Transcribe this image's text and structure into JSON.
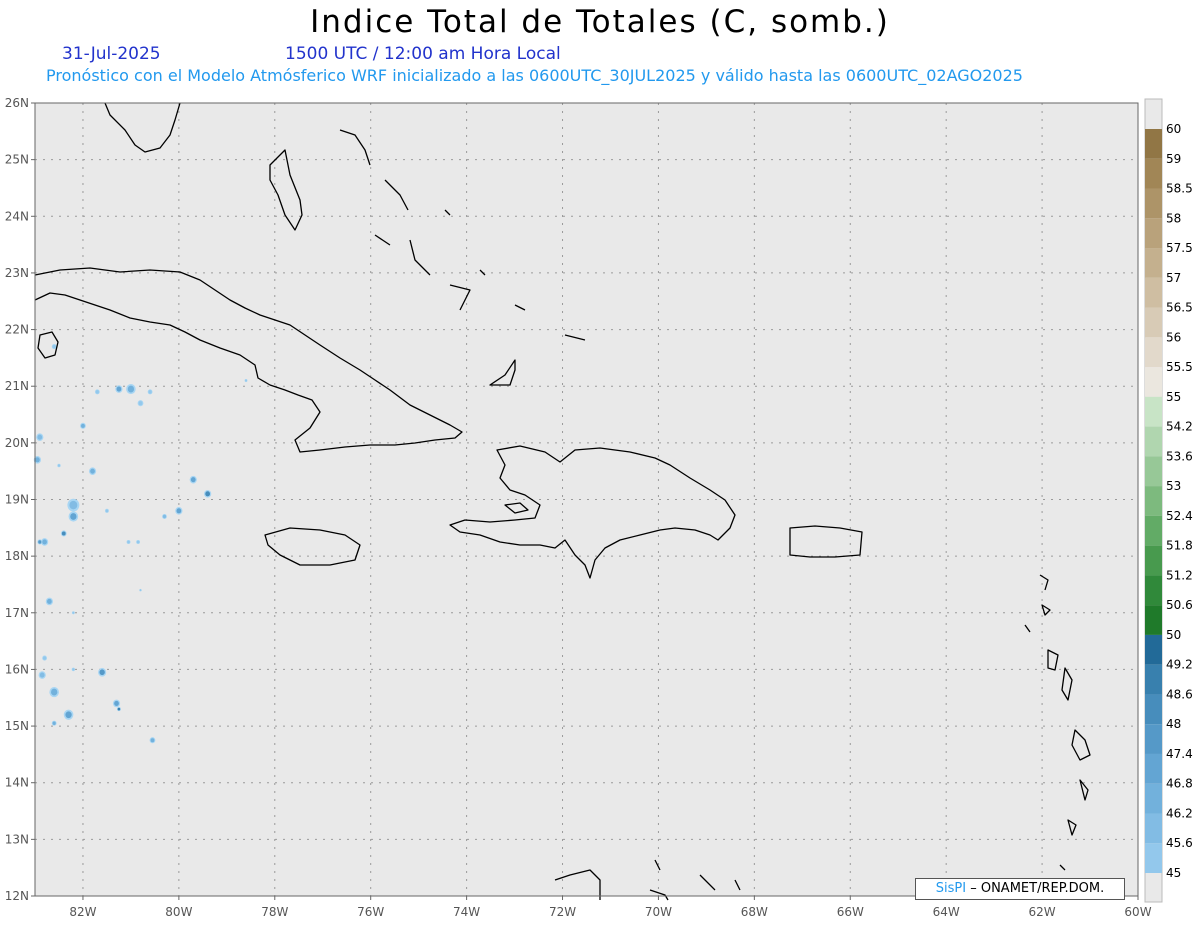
{
  "header": {
    "title": "Indice Total de Totales (C, somb.)",
    "date": "31-Jul-2025",
    "time": "1500 UTC / 12:00 am Hora Local",
    "subtitle": "Pronóstico con el Modelo Atmósferico WRF inicializado a las 0600UTC_30JUL2025 y válido hasta las  0600UTC_02AGO2025"
  },
  "credit": {
    "brand": "SisPI",
    "org": " – ONAMET/REP.DOM."
  },
  "map": {
    "lon_range": [
      -83,
      -60
    ],
    "lat_range": [
      12,
      26
    ],
    "lon_ticks": [
      {
        "lon": -82,
        "label": "82W"
      },
      {
        "lon": -80,
        "label": "80W"
      },
      {
        "lon": -78,
        "label": "78W"
      },
      {
        "lon": -76,
        "label": "76W"
      },
      {
        "lon": -74,
        "label": "74W"
      },
      {
        "lon": -72,
        "label": "72W"
      },
      {
        "lon": -70,
        "label": "70W"
      },
      {
        "lon": -68,
        "label": "68W"
      },
      {
        "lon": -66,
        "label": "66W"
      },
      {
        "lon": -64,
        "label": "64W"
      },
      {
        "lon": -62,
        "label": "62W"
      },
      {
        "lon": -60,
        "label": "60W"
      }
    ],
    "lat_ticks": [
      {
        "lat": 26,
        "label": "26N"
      },
      {
        "lat": 25,
        "label": "25N"
      },
      {
        "lat": 24,
        "label": "24N"
      },
      {
        "lat": 23,
        "label": "23N"
      },
      {
        "lat": 22,
        "label": "22N"
      },
      {
        "lat": 21,
        "label": "21N"
      },
      {
        "lat": 20,
        "label": "20N"
      },
      {
        "lat": 19,
        "label": "19N"
      },
      {
        "lat": 18,
        "label": "18N"
      },
      {
        "lat": 17,
        "label": "17N"
      },
      {
        "lat": 16,
        "label": "16N"
      },
      {
        "lat": 15,
        "label": "15N"
      },
      {
        "lat": 14,
        "label": "14N"
      },
      {
        "lat": 13,
        "label": "13N"
      },
      {
        "lat": 12,
        "label": "12N"
      }
    ],
    "grid": true,
    "background": "#e9e9e9",
    "coastline_color": "#000000"
  },
  "colorbar": {
    "levels": [
      {
        "label": "45",
        "color": "#a9d6f3"
      },
      {
        "label": "45.6",
        "color": "#93c8ec"
      },
      {
        "label": "46.2",
        "color": "#82bce4"
      },
      {
        "label": "46.8",
        "color": "#72b1dc"
      },
      {
        "label": "47.4",
        "color": "#63a5d3"
      },
      {
        "label": "48",
        "color": "#5599c8"
      },
      {
        "label": "48.6",
        "color": "#478dbc"
      },
      {
        "label": "49.2",
        "color": "#3880ae"
      },
      {
        "label": "50",
        "color": "#226a98"
      },
      {
        "label": "50.6",
        "color": "#1f7a2a"
      },
      {
        "label": "51.2",
        "color": "#30893a"
      },
      {
        "label": "51.8",
        "color": "#489a4e"
      },
      {
        "label": "52.4",
        "color": "#62ab66"
      },
      {
        "label": "53",
        "color": "#7dba7e"
      },
      {
        "label": "53.6",
        "color": "#97c897"
      },
      {
        "label": "54.2",
        "color": "#b0d6af"
      },
      {
        "label": "55",
        "color": "#c8e4c6"
      },
      {
        "label": "55.5",
        "color": "#ebe7df"
      },
      {
        "label": "56",
        "color": "#e2d9cb"
      },
      {
        "label": "56.5",
        "color": "#d8cbb6"
      },
      {
        "label": "57",
        "color": "#cfbea2"
      },
      {
        "label": "57.5",
        "color": "#c4b08e"
      },
      {
        "label": "58",
        "color": "#b9a27b"
      },
      {
        "label": "58.5",
        "color": "#ad9468"
      },
      {
        "label": "59",
        "color": "#a18656"
      },
      {
        "label": "60",
        "color": "#917645"
      }
    ]
  },
  "cells": [
    {
      "lon": -82.9,
      "lat": 20.1,
      "r": 0.15,
      "v": 46.2
    },
    {
      "lon": -82.95,
      "lat": 19.7,
      "r": 0.15,
      "v": 46.8
    },
    {
      "lon": -82.2,
      "lat": 18.9,
      "r": 0.25,
      "v": 46.2
    },
    {
      "lon": -82.2,
      "lat": 18.7,
      "r": 0.2,
      "v": 47.4
    },
    {
      "lon": -82.4,
      "lat": 18.4,
      "r": 0.12,
      "v": 48.6
    },
    {
      "lon": -82.8,
      "lat": 18.25,
      "r": 0.15,
      "v": 46.8
    },
    {
      "lon": -82.9,
      "lat": 18.25,
      "r": 0.1,
      "v": 48
    },
    {
      "lon": -81.8,
      "lat": 19.5,
      "r": 0.15,
      "v": 46.8
    },
    {
      "lon": -82.5,
      "lat": 19.6,
      "r": 0.07,
      "v": 45.6
    },
    {
      "lon": -81.0,
      "lat": 20.95,
      "r": 0.2,
      "v": 46.8
    },
    {
      "lon": -81.25,
      "lat": 20.95,
      "r": 0.15,
      "v": 47.4
    },
    {
      "lon": -81.7,
      "lat": 20.9,
      "r": 0.1,
      "v": 45.6
    },
    {
      "lon": -80.6,
      "lat": 20.9,
      "r": 0.1,
      "v": 45.6
    },
    {
      "lon": -80.8,
      "lat": 20.7,
      "r": 0.12,
      "v": 45.6
    },
    {
      "lon": -82.0,
      "lat": 20.3,
      "r": 0.12,
      "v": 46.8
    },
    {
      "lon": -79.7,
      "lat": 19.35,
      "r": 0.15,
      "v": 47.4
    },
    {
      "lon": -79.4,
      "lat": 19.1,
      "r": 0.15,
      "v": 48.6
    },
    {
      "lon": -80.0,
      "lat": 18.8,
      "r": 0.15,
      "v": 47.4
    },
    {
      "lon": -80.3,
      "lat": 18.7,
      "r": 0.1,
      "v": 46.2
    },
    {
      "lon": -82.7,
      "lat": 17.2,
      "r": 0.15,
      "v": 46.8
    },
    {
      "lon": -82.2,
      "lat": 17.0,
      "r": 0.06,
      "v": 45.6
    },
    {
      "lon": -81.6,
      "lat": 15.95,
      "r": 0.17,
      "v": 48
    },
    {
      "lon": -81.3,
      "lat": 15.4,
      "r": 0.15,
      "v": 47.4
    },
    {
      "lon": -81.25,
      "lat": 15.3,
      "r": 0.08,
      "v": 49.2
    },
    {
      "lon": -82.6,
      "lat": 15.6,
      "r": 0.2,
      "v": 46.8
    },
    {
      "lon": -82.3,
      "lat": 15.2,
      "r": 0.2,
      "v": 47.4
    },
    {
      "lon": -82.6,
      "lat": 15.05,
      "r": 0.1,
      "v": 46.8
    },
    {
      "lon": -82.85,
      "lat": 15.9,
      "r": 0.15,
      "v": 46.2
    },
    {
      "lon": -82.8,
      "lat": 16.2,
      "r": 0.1,
      "v": 45.6
    },
    {
      "lon": -80.55,
      "lat": 14.75,
      "r": 0.12,
      "v": 46.8
    },
    {
      "lon": -80.85,
      "lat": 18.25,
      "r": 0.08,
      "v": 45.6
    },
    {
      "lon": -81.05,
      "lat": 18.25,
      "r": 0.08,
      "v": 45.6
    },
    {
      "lon": -78.6,
      "lat": 21.1,
      "r": 0.06,
      "v": 45.6
    },
    {
      "lon": -82.2,
      "lat": 16.0,
      "r": 0.07,
      "v": 45.6
    },
    {
      "lon": -81.5,
      "lat": 18.8,
      "r": 0.08,
      "v": 45.6
    },
    {
      "lon": -80.8,
      "lat": 17.4,
      "r": 0.05,
      "v": 45.6
    },
    {
      "lon": -82.6,
      "lat": 21.7,
      "r": 0.1,
      "v": 45.6
    }
  ]
}
